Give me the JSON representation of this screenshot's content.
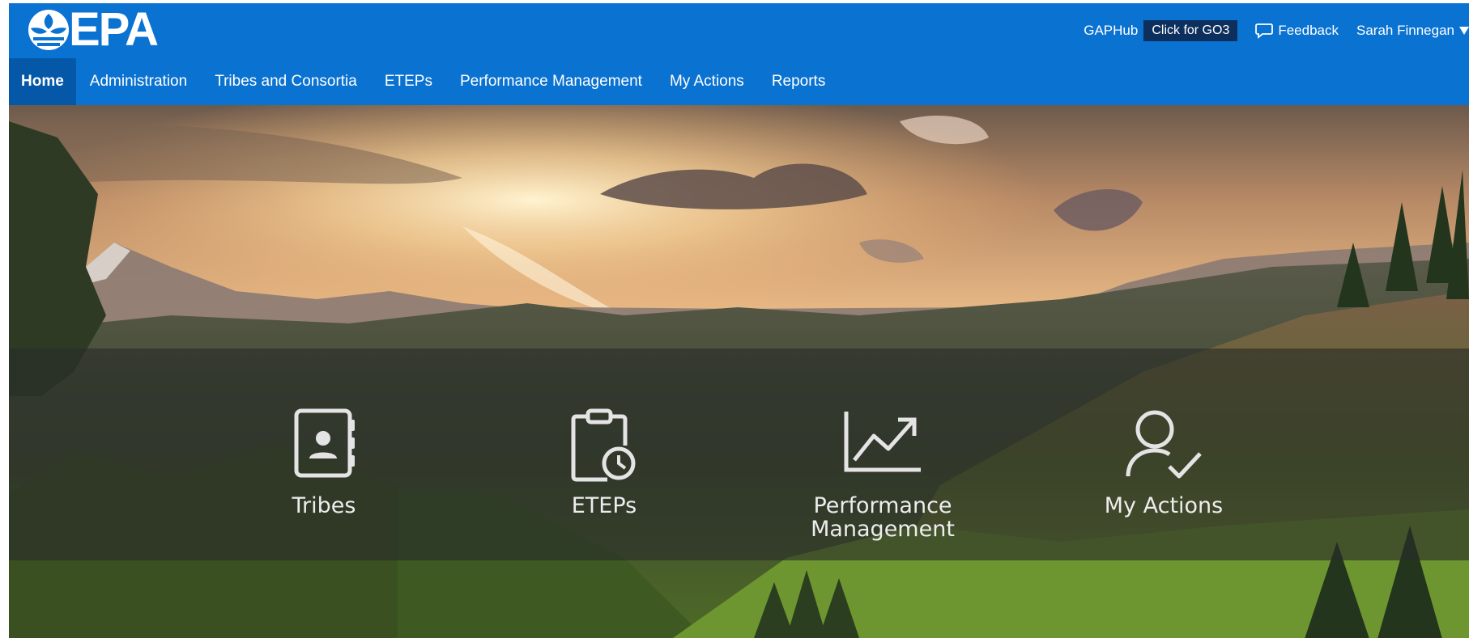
{
  "header": {
    "logo_text": "EPA",
    "logo_icon": "epa-flower-icon",
    "gaphub_label": "GAPHub",
    "go3_button_label": "Click for GO3",
    "feedback_label": "Feedback",
    "feedback_icon": "speech-bubble-icon",
    "user_name": "Sarah Finnegan",
    "brand_color": "#0a72d1"
  },
  "nav": {
    "items": [
      {
        "label": "Home",
        "active": true
      },
      {
        "label": "Administration"
      },
      {
        "label": "Tribes and Consortia"
      },
      {
        "label": "ETEPs"
      },
      {
        "label": "Performance Management"
      },
      {
        "label": "My Actions"
      },
      {
        "label": "Reports"
      }
    ]
  },
  "hero": {
    "image": "mountain-sunset-landscape",
    "tiles": [
      {
        "label": "Tribes",
        "icon": "contact-book-icon"
      },
      {
        "label": "ETEPs",
        "icon": "clipboard-clock-icon"
      },
      {
        "label": "Performance Management",
        "label_line1": "Performance",
        "label_line2": "Management",
        "icon": "trend-chart-icon"
      },
      {
        "label": "My Actions",
        "icon": "user-check-icon"
      }
    ]
  }
}
